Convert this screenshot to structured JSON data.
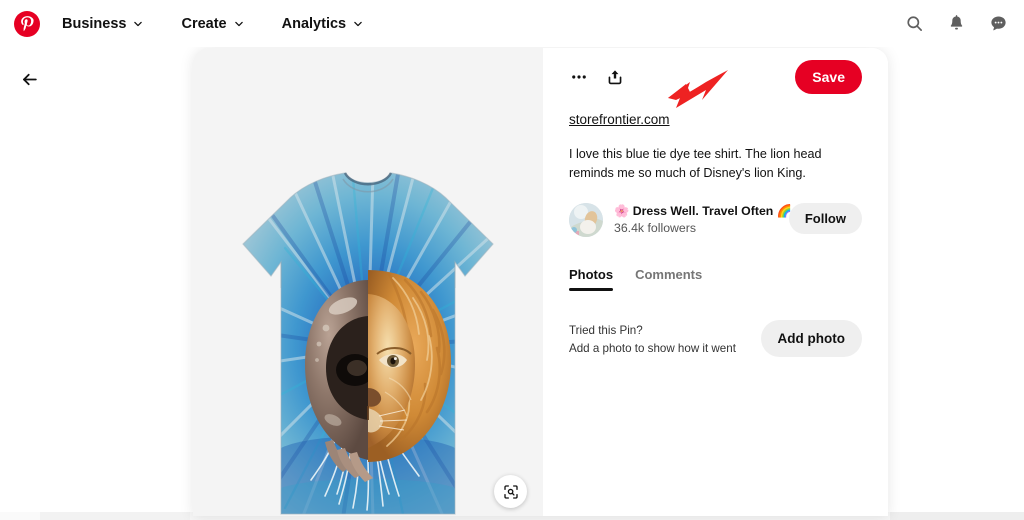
{
  "header": {
    "logo_icon": "pinterest-logo-icon",
    "nav": [
      {
        "label": "Business",
        "icon": "chevron-down-icon"
      },
      {
        "label": "Create",
        "icon": "chevron-down-icon"
      },
      {
        "label": "Analytics",
        "icon": "chevron-down-icon"
      }
    ],
    "actions": [
      {
        "name": "search-icon"
      },
      {
        "name": "notifications-bell-icon"
      },
      {
        "name": "messages-icon"
      }
    ]
  },
  "back": {
    "icon": "back-arrow-icon"
  },
  "pin": {
    "image": {
      "alt": "blue tie dye t-shirt with lion head graphic",
      "lens_icon": "visual-search-icon",
      "background": "#f4f4f4"
    },
    "actions": {
      "more_icon": "more-options-icon",
      "share_icon": "share-icon",
      "save_label": "Save",
      "save_color": "#e60023"
    },
    "source_link": "storefrontier.com",
    "description": "I love this blue tie dye tee shirt. The lion head reminds me so much of Disney's lion King.",
    "profile": {
      "avatar_icon": "avatar",
      "name": "🌸 Dress Well. Travel Often 🌈",
      "followers": "36.4k followers",
      "follow_label": "Follow"
    },
    "tabs": [
      {
        "label": "Photos",
        "active": true
      },
      {
        "label": "Comments",
        "active": false
      }
    ],
    "tried": {
      "title": "Tried this Pin?",
      "subtitle": "Add a photo to show how it went",
      "button_label": "Add photo"
    }
  },
  "annotation": {
    "arrow_color": "#ee2222",
    "points_to": "storefrontier.com"
  }
}
